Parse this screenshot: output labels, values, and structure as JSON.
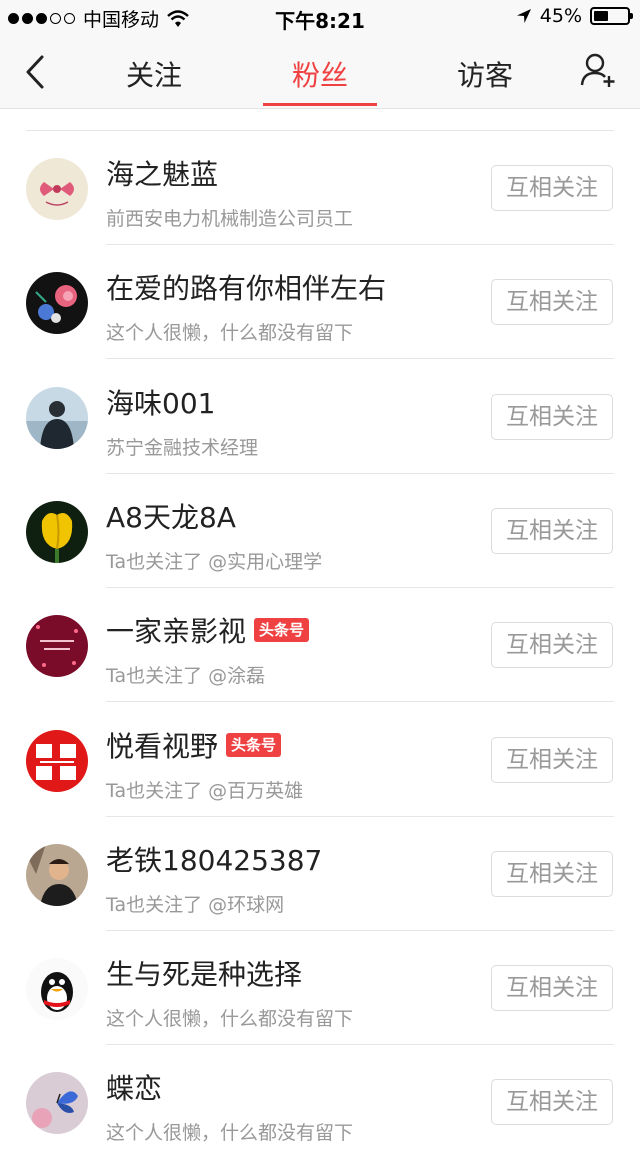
{
  "status": {
    "carrier": "中国移动",
    "time": "下午8:21",
    "battery": "45%",
    "battery_level": 0.45
  },
  "nav": {
    "tabs": [
      {
        "label": "关注"
      },
      {
        "label": "粉丝"
      },
      {
        "label": "访客"
      }
    ],
    "active_tab": 1
  },
  "colors": {
    "accent": "#f04142"
  },
  "follow_label": "互相关注",
  "badge_label": "头条号",
  "fans": [
    {
      "name": "海之魅蓝",
      "desc": "前西安电力机械制造公司员工",
      "badge": false,
      "avatar": "bow-icon"
    },
    {
      "name": "在爱的路有你相伴左右",
      "desc": "这个人很懒，什么都没有留下",
      "badge": false,
      "avatar": "flowers-icon"
    },
    {
      "name": "海味001",
      "desc": "苏宁金融技术经理",
      "badge": false,
      "avatar": "person-sea-icon"
    },
    {
      "name": "A8天龙8A",
      "desc": "Ta也关注了 @实用心理学",
      "badge": false,
      "avatar": "tulip-icon"
    },
    {
      "name": "一家亲影视",
      "desc": "Ta也关注了 @涂磊",
      "badge": true,
      "avatar": "heart-pattern-icon"
    },
    {
      "name": "悦看视野",
      "desc": "Ta也关注了 @百万英雄",
      "badge": true,
      "avatar": "red-logo-icon"
    },
    {
      "name": "老铁180425387",
      "desc": "Ta也关注了 @环球网",
      "badge": false,
      "avatar": "man-photo-icon"
    },
    {
      "name": "生与死是种选择",
      "desc": "这个人很懒，什么都没有留下",
      "badge": false,
      "avatar": "penguin-icon"
    },
    {
      "name": "蝶恋",
      "desc": "这个人很懒，什么都没有留下",
      "badge": false,
      "avatar": "butterfly-icon"
    }
  ]
}
